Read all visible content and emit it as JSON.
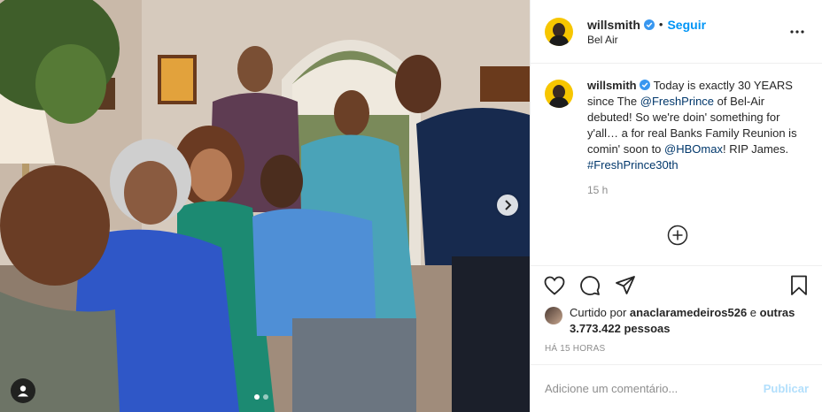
{
  "post": {
    "username": "willsmith",
    "verified": true,
    "separator": "•",
    "follow_label": "Seguir",
    "location": "Bel Air",
    "caption": {
      "username": "willsmith",
      "text_1": "Today is exactly 30 YEARS since The ",
      "mention_1": "@FreshPrince",
      "text_2": " of Bel-Air debuted! So we're doin' something for y'all… a for real Banks Family Reunion is comin' soon to ",
      "mention_2": "@HBOmax",
      "text_3": "! RIP James. ",
      "hashtag": "#FreshPrince30th"
    },
    "caption_time": "15 h",
    "likes": {
      "prefix": "Curtido por ",
      "liker": "anaclaramedeiros526",
      "middle": " e ",
      "others": "outras 3.773.422 pessoas"
    },
    "posted_ago": "HÁ 15 HORAS",
    "comment_placeholder": "Adicione um comentário...",
    "publish_label": "Publicar"
  },
  "carousel": {
    "slide_count": 2,
    "active_slide": 1
  },
  "icons": {
    "more": "more-options-icon",
    "verified": "verified-badge-icon",
    "like": "heart-icon",
    "comment": "comment-bubble-icon",
    "share": "paper-plane-icon",
    "save": "bookmark-icon",
    "load_more": "plus-circle-icon",
    "next": "chevron-right-icon",
    "tag": "user-tag-icon"
  },
  "colors": {
    "link": "#00376b",
    "accent": "#0095f6",
    "muted": "#8e8e8e",
    "publish_disabled": "#b2dffc",
    "verified": "#3897f0"
  }
}
